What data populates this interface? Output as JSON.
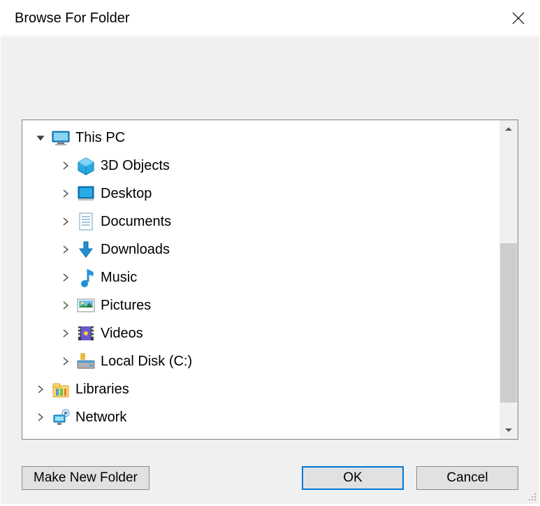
{
  "title": "Browse For Folder",
  "tree": {
    "root": {
      "label": "This PC"
    },
    "children": [
      {
        "label": "3D Objects"
      },
      {
        "label": "Desktop"
      },
      {
        "label": "Documents"
      },
      {
        "label": "Downloads"
      },
      {
        "label": "Music"
      },
      {
        "label": "Pictures"
      },
      {
        "label": "Videos"
      },
      {
        "label": "Local Disk (C:)"
      }
    ],
    "siblings": [
      {
        "label": "Libraries"
      },
      {
        "label": "Network"
      }
    ]
  },
  "buttons": {
    "make_new_folder": "Make New Folder",
    "ok": "OK",
    "cancel": "Cancel"
  }
}
